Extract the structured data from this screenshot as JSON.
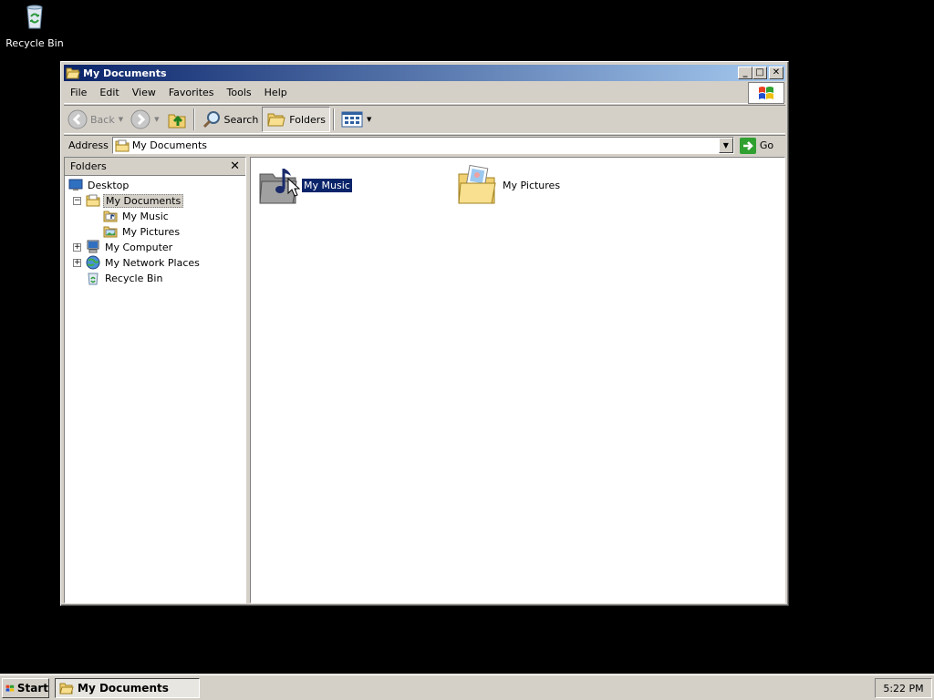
{
  "desktop": {
    "icons": [
      {
        "label": "Recycle Bin",
        "icon": "recycle-bin-icon"
      }
    ]
  },
  "window": {
    "title": "My Documents",
    "title_icon": "open-folder-icon",
    "controls": {
      "minimize": "minimize-icon",
      "maximize": "maximize-icon",
      "close": "close-icon"
    }
  },
  "menu": {
    "items": [
      "File",
      "Edit",
      "View",
      "Favorites",
      "Tools",
      "Help"
    ]
  },
  "toolbar": {
    "back_label": "Back",
    "search_label": "Search",
    "folders_label": "Folders"
  },
  "address": {
    "label": "Address",
    "value": "My Documents",
    "go_label": "Go"
  },
  "folders_pane": {
    "title": "Folders",
    "tree": [
      {
        "label": "Desktop",
        "icon": "desktop-icon",
        "expander": ""
      },
      {
        "label": "My Documents",
        "icon": "documents-folder-icon",
        "expander": "−",
        "selected": true
      },
      {
        "label": "My Music",
        "icon": "music-folder-icon",
        "expander": ""
      },
      {
        "label": "My Pictures",
        "icon": "pictures-folder-icon",
        "expander": ""
      },
      {
        "label": "My Computer",
        "icon": "computer-icon",
        "expander": "+"
      },
      {
        "label": "My Network Places",
        "icon": "network-icon",
        "expander": "+"
      },
      {
        "label": "Recycle Bin",
        "icon": "recycle-bin-icon",
        "expander": ""
      }
    ]
  },
  "content": {
    "items": [
      {
        "label": "My Music",
        "icon": "music-folder-icon",
        "selected": true
      },
      {
        "label": "My Pictures",
        "icon": "pictures-folder-icon",
        "selected": false
      }
    ]
  },
  "taskbar": {
    "start_label": "Start",
    "task_label": "My Documents",
    "clock": "5:22 PM"
  },
  "colors": {
    "desktop": "#000000",
    "titlebar_start": "#0a246a",
    "titlebar_end": "#a6caf0",
    "face": "#d4d0c8",
    "selection": "#0a246a"
  }
}
